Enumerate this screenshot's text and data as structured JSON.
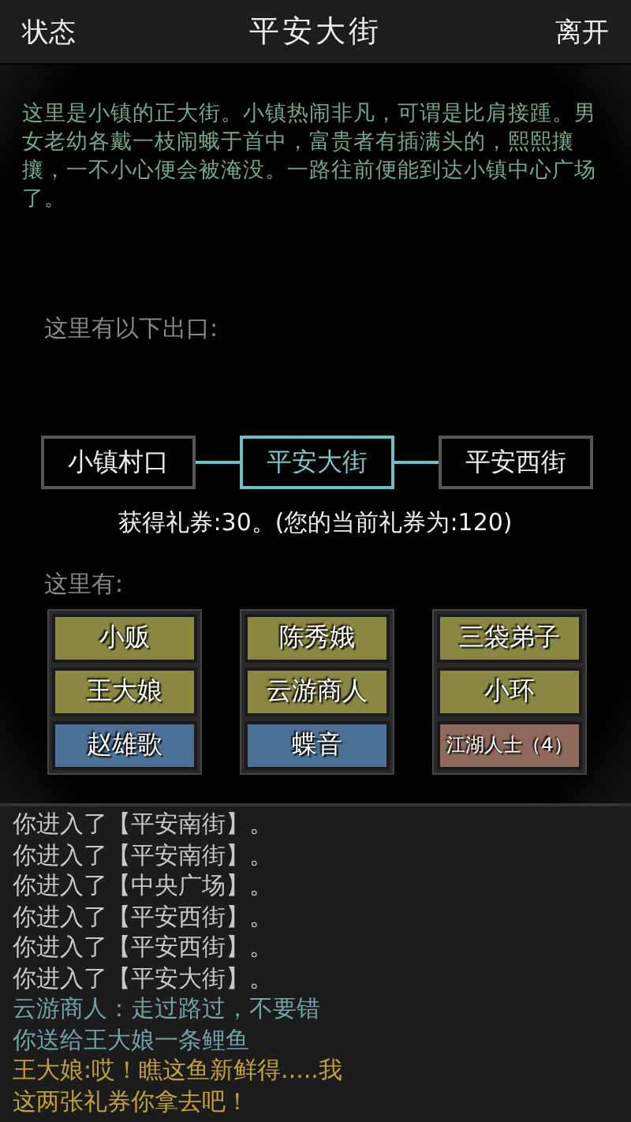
{
  "header": {
    "left_button": "状态",
    "title": "平安大街",
    "right_button": "离开"
  },
  "description": "这里是小镇的正大街。小镇热闹非凡，可谓是比肩接踵。男女老幼各戴一枝闹蛾于首中，富贵者有插满头的，熙熙攘攘，一不小心便会被淹没。一路往前便能到达小镇中心广场了。",
  "exits_label": "这里有以下出口:",
  "exits": [
    {
      "label": "小镇村口",
      "selected": false
    },
    {
      "label": "平安大街",
      "selected": true
    },
    {
      "label": "平安西街",
      "selected": false
    }
  ],
  "reward": "获得礼券:30。(您的当前礼券为:120)",
  "people_label": "这里有:",
  "people_columns": [
    [
      {
        "label": "小贩",
        "color": "#8a8742"
      },
      {
        "label": "王大娘",
        "color": "#8a8742"
      },
      {
        "label": "赵雄歌",
        "color": "#4d7196"
      }
    ],
    [
      {
        "label": "陈秀娥",
        "color": "#8a8742"
      },
      {
        "label": "云游商人",
        "color": "#8a8742"
      },
      {
        "label": "蝶音",
        "color": "#4d7196"
      }
    ],
    [
      {
        "label": "三袋弟子",
        "color": "#8a8742"
      },
      {
        "label": "小环",
        "color": "#8a8742"
      },
      {
        "label": "江湖人士（4）",
        "color": "#8f6a5c",
        "kind": "small"
      }
    ]
  ],
  "log": [
    {
      "text": "你进入了【平安南街】。",
      "color": "#c8c8c8"
    },
    {
      "text": "你进入了【平安南街】。",
      "color": "#c8c8c8"
    },
    {
      "text": "你进入了【中央广场】。",
      "color": "#c8c8c8"
    },
    {
      "text": "你进入了【平安西街】。",
      "color": "#c8c8c8"
    },
    {
      "text": "你进入了【平安西街】。",
      "color": "#c8c8c8"
    },
    {
      "text": "你进入了【平安大街】。",
      "color": "#c8c8c8"
    },
    {
      "text": "云游商人：走过路过，不要错",
      "color": "#6fa3a6"
    },
    {
      "text": "你送给王大娘一条鲤鱼",
      "color": "#6fa3a6"
    },
    {
      "text": "王大娘:哎！瞧这鱼新鲜得.....我",
      "color": "#c2a238"
    },
    {
      "text": "这两张礼券你拿去吧！",
      "color": "#c2a238"
    }
  ]
}
